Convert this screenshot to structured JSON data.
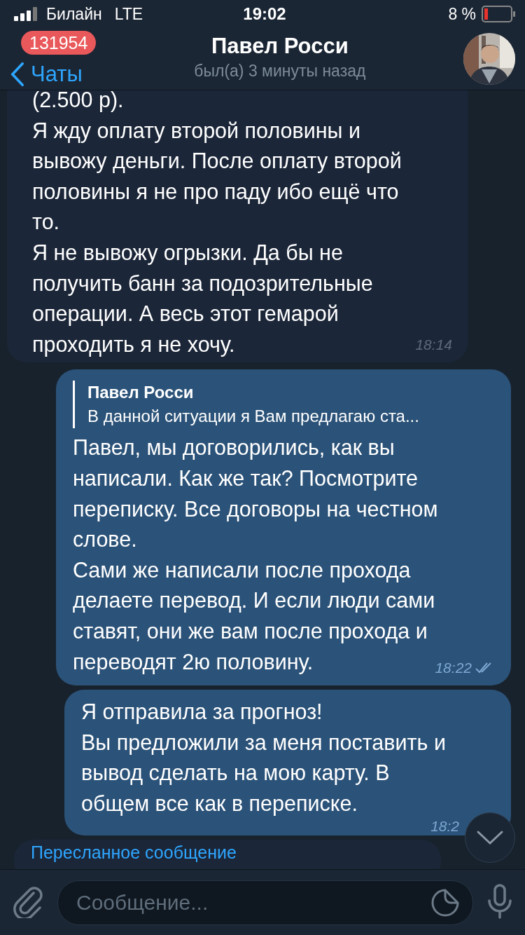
{
  "status_bar": {
    "carrier": "Билайн",
    "network": "LTE",
    "time": "19:02",
    "battery": "8 %"
  },
  "header": {
    "back": "Чаты",
    "badge": "131954",
    "title": "Павел Росси",
    "subtitle": "был(а) 3 минуты назад"
  },
  "messages": [
    {
      "kind": "incoming",
      "text": "(2.500 р).\nЯ жду оплату второй половины и\nвывожу деньги. После оплату второй\nполовины я не про паду ибо ещё что\nто.\nЯ не вывожу огрызки. Да бы не\nполучить банн за подозрительные\nоперации. А весь этот гемарой\nпроходить я не хочу.",
      "time": "18:14"
    },
    {
      "kind": "outgoing",
      "reply": {
        "name": "Павел Росси",
        "text": "В данной ситуации я Вам предлагаю ста..."
      },
      "text": "Павел, мы договорились, как вы\nнаписали. Как же так? Посмотрите\nпереписку. Все договоры на честном\nслове.\nСами же написали после прохода\nделаете перевод. И если люди сами\nставят, они же вам после прохода и\nпереводят 2ю половину.",
      "time": "18:22",
      "read": true
    },
    {
      "kind": "outgoing",
      "text": "Я отправила за прогноз!\nВы предложили за меня поставить и\nвывод сделать на мою карту. В\nобщем все как в переписке.",
      "time": "18:2"
    },
    {
      "kind": "forwarded",
      "label": "Пересланное сообщение"
    }
  ],
  "composer": {
    "placeholder": "Сообщение..."
  }
}
